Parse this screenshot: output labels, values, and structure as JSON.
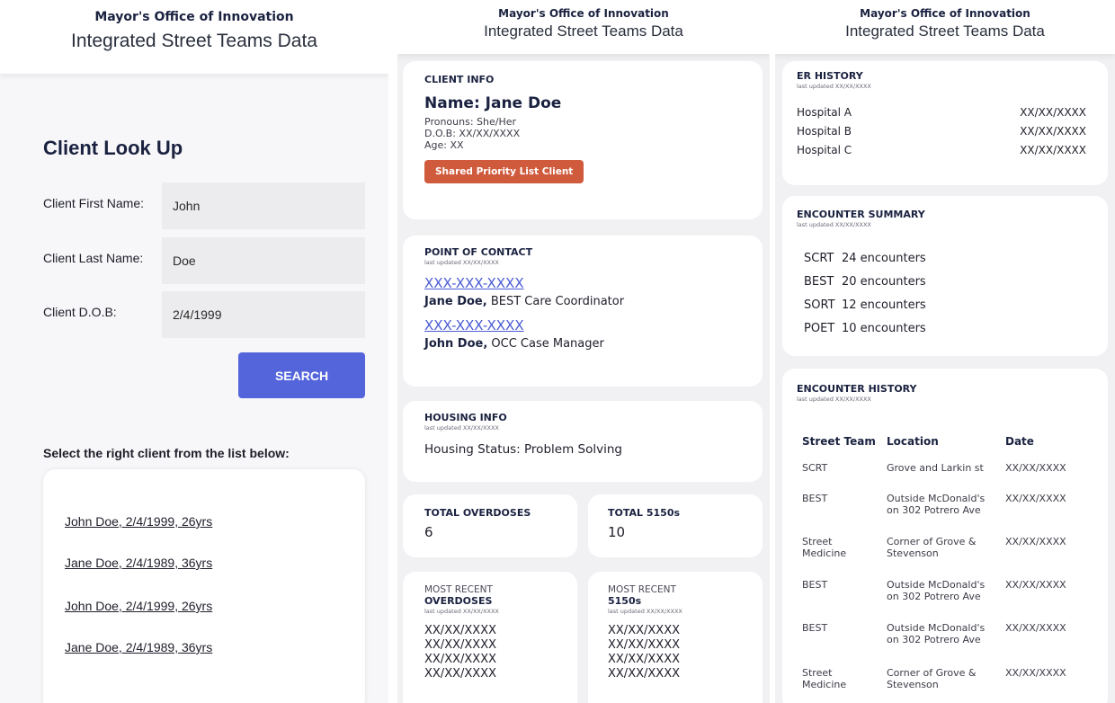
{
  "header": {
    "org": "Mayor's Office of Innovation",
    "title": "Integrated Street Teams Data"
  },
  "lookup": {
    "title": "Client Look Up",
    "fields": [
      {
        "label": "Client First Name:",
        "value": "John"
      },
      {
        "label": "Client Last Name:",
        "value": "Doe"
      },
      {
        "label": "Client D.O.B:",
        "value": "2/4/1999"
      }
    ],
    "search_label": "SEARCH",
    "select_prompt": "Select the right client from the list below:",
    "results": [
      "John Doe, 2/4/1999, 26yrs",
      "Jane Doe, 2/4/1989, 36yrs",
      "John Doe, 2/4/1999, 26yrs",
      "Jane Doe, 2/4/1989, 36yrs"
    ]
  },
  "profile": {
    "client_info": {
      "section": "CLIENT INFO",
      "name": "Name: Jane Doe",
      "pronouns": "Pronouns: She/Her",
      "dob": "D.O.B: XX/XX/XXXX",
      "age": "Age: XX",
      "badge": "Shared Priority List Client"
    },
    "point_of_contact": {
      "section": "POINT OF CONTACT",
      "updated": "last updated XX/XX/XXXX",
      "contacts": [
        {
          "phone": "XXX-XXX-XXXX",
          "name": "Jane Doe,",
          "role": " BEST Care Coordinator"
        },
        {
          "phone": "XXX-XXX-XXXX",
          "name": "John Doe,",
          "role": " OCC Case Manager"
        }
      ]
    },
    "housing": {
      "section": "HOUSING INFO",
      "updated": "last updated XX/XX/XXXX",
      "status": "Housing Status: Problem Solving"
    },
    "totals": {
      "overdoses_label": "TOTAL OVERDOSES",
      "overdoses_value": "6",
      "t5150_label": "TOTAL 5150s",
      "t5150_value": "10"
    },
    "recent": [
      {
        "prefix": "MOST RECENT",
        "label": "OVERDOSES",
        "updated": "last updated XX/XX/XXXX",
        "dates": [
          "XX/XX/XXXX",
          "XX/XX/XXXX",
          "XX/XX/XXXX",
          "XX/XX/XXXX"
        ]
      },
      {
        "prefix": "MOST RECENT",
        "label": "5150s",
        "updated": "last updated XX/XX/XXXX",
        "dates": [
          "XX/XX/XXXX",
          "XX/XX/XXXX",
          "XX/XX/XXXX",
          "XX/XX/XXXX"
        ]
      }
    ]
  },
  "history": {
    "er": {
      "section": "ER HISTORY",
      "updated": "last updated XX/XX/XXXX",
      "rows": [
        {
          "name": "Hospital A",
          "date": "XX/XX/XXXX"
        },
        {
          "name": "Hospital B",
          "date": "XX/XX/XXXX"
        },
        {
          "name": "Hospital C",
          "date": "XX/XX/XXXX"
        }
      ]
    },
    "summary": {
      "section": "ENCOUNTER SUMMARY",
      "updated": "last updated XX/XX/XXXX",
      "rows": [
        {
          "team": "SCRT",
          "count": "24 encounters"
        },
        {
          "team": "BEST",
          "count": "20 encounters"
        },
        {
          "team": "SORT",
          "count": "12 encounters"
        },
        {
          "team": "POET",
          "count": "10 encounters"
        }
      ]
    },
    "encounters": {
      "section": "ENCOUNTER HISTORY",
      "updated": "last updated XX/XX/XXXX",
      "columns": [
        "Street Team",
        "Location",
        "Date"
      ],
      "rows": [
        {
          "team": "SCRT",
          "location": "Grove and Larkin st",
          "date": "XX/XX/XXXX"
        },
        {
          "team": "BEST",
          "location": "Outside McDonald's on 302 Potrero Ave",
          "date": "XX/XX/XXXX"
        },
        {
          "team": "Street Medicine",
          "location": "Corner of Grove & Stevenson",
          "date": "XX/XX/XXXX"
        },
        {
          "team": "BEST",
          "location": "Outside McDonald's on 302 Potrero Ave",
          "date": "XX/XX/XXXX"
        },
        {
          "team": "BEST",
          "location": "Outside McDonald's on 302 Potrero Ave",
          "date": "XX/XX/XXXX"
        },
        {
          "team": "Street Medicine",
          "location": "Corner of Grove & Stevenson",
          "date": "XX/XX/XXXX"
        }
      ]
    }
  }
}
